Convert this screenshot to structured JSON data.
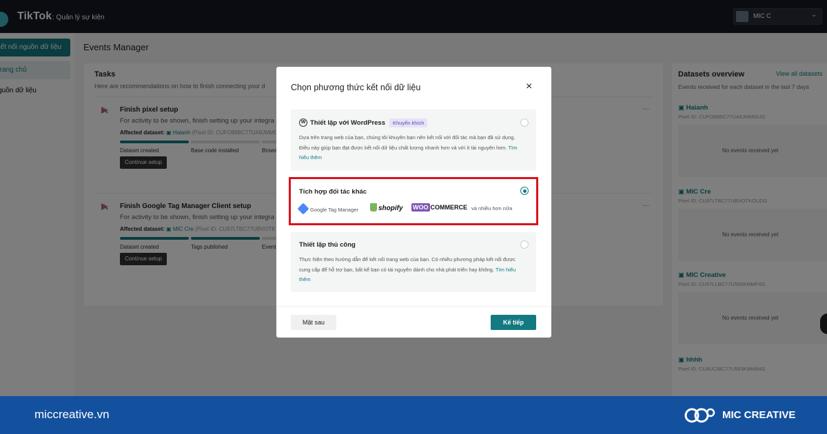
{
  "topbar": {
    "brand": "TikTok",
    "brand_sub": ": Quản lý sự kiện",
    "account_name": "MIC C",
    "account_chevron": "⌄"
  },
  "sidebar": {
    "primary_button": "Kết nối nguồn dữ liệu",
    "items": [
      {
        "label": "Trang chủ"
      },
      {
        "label": "Nguồn dữ liệu"
      }
    ]
  },
  "main": {
    "title": "Events Manager",
    "tasks": {
      "title": "Tasks",
      "description": "Here are recommendations on how to finish connecting your d",
      "items": [
        {
          "title": "Finish pixel setup",
          "description": "For activity to be shown, finish setting up your integra",
          "dataset_label": "Affected dataset:",
          "dataset_name": "Haianh",
          "pixel_id": "(Pixel ID: CUFO86BC77UA8JMMOU",
          "steps": [
            {
              "label": "Dataset created",
              "done": true
            },
            {
              "label": "Base code installed",
              "done": false
            },
            {
              "label": "Brows",
              "done": false
            }
          ],
          "button": "Continue setup"
        },
        {
          "title": "Finish Google Tag Manager Client setup",
          "description": "For activity to be shown, finish setting up your integra",
          "dataset_label": "Affected dataset:",
          "dataset_name": "MIC Cre",
          "pixel_id": "(Pixel ID: CU97LTBC77UBVOTK",
          "steps": [
            {
              "label": "Dataset created",
              "done": true
            },
            {
              "label": "Tags published",
              "done": true
            },
            {
              "label": "Event",
              "done": false
            }
          ],
          "button": "Continue setup"
        }
      ]
    }
  },
  "datasets": {
    "title": "Datasets overview",
    "link": "View all datasets",
    "description": "Events received for each dataset in the last 7 days",
    "items": [
      {
        "name": "Haianh",
        "pixel": "Pixel ID: CUFO86BC77UA8JMMOUG",
        "empty": "No events received yet"
      },
      {
        "name": "MIC Cre",
        "pixel": "Pixel ID: CU97LTBC77UBVOTKOUDG",
        "empty": "No events received yet"
      },
      {
        "name": "MIC Creative",
        "pixel": "Pixel ID: CU97LLBC77U593KMMF4G",
        "empty": "No events received yet"
      },
      {
        "name": "hhhh",
        "pixel": "Pixel ID: CU8UCIBC77U593KMM64G",
        "empty": ""
      }
    ]
  },
  "modal": {
    "title": "Chọn phương thức kết nối dữ liệu",
    "close": "×",
    "options": [
      {
        "title": "Thiết lập với WordPress",
        "badge": "Khuyến khích",
        "description": "Dựa trên trang web của bạn, chúng tôi khuyên bạn nên kết nối với đối tác mà bạn đã sử dụng. Điều này giúp bạn đạt được kết nối dữ liệu chất lượng nhanh hơn và với ít tài nguyên hơn.",
        "more": "Tìm hiểu thêm",
        "selected": false
      },
      {
        "title": "Tích hợp đối tác khác",
        "partners": {
          "gtm": "Google Tag Manager",
          "shopify": "shopify",
          "woo_w": "WOO",
          "woo_rest": "COMMERCE",
          "more": "và nhiều hơn nữa"
        },
        "selected": true
      },
      {
        "title": "Thiết lập thủ công",
        "description": "Thực hiện theo hướng dẫn để kết nối trang web của bạn. Có nhiều phương pháp kết nối được cung cấp để hỗ trợ bạn, bất kể bạn có tài nguyên dành cho nhà phát triển hay không.",
        "more": "Tìm hiểu thêm",
        "selected": false
      }
    ],
    "back_button": "Mặt sau",
    "next_button": "Kế tiếp"
  },
  "footer_bar": {
    "site": "miccreative.vn",
    "brand_name": "MIC CREATIVE"
  },
  "colors": {
    "accent": "#137a82",
    "highlight": "#d9121f",
    "brand_bar": "#13519e"
  }
}
